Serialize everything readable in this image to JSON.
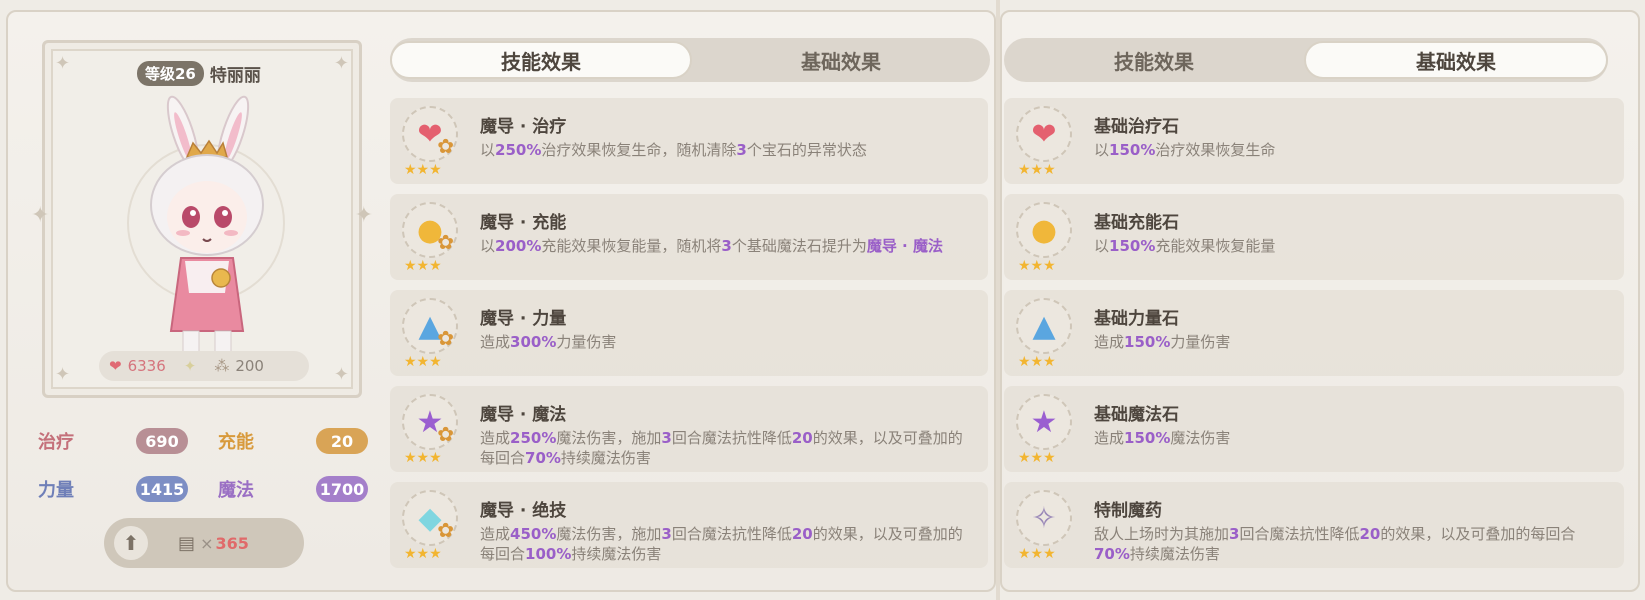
{
  "character": {
    "level_badge": "等级26",
    "name": "特丽丽",
    "hp": "6336",
    "gem_power": "200"
  },
  "attributes": [
    {
      "label": "治疗",
      "value": "690",
      "label_color": "#c4707a",
      "pill_color": "#b88f95"
    },
    {
      "label": "充能",
      "value": "20",
      "label_color": "#d89a3c",
      "pill_color": "#d9a456"
    },
    {
      "label": "力量",
      "value": "1415",
      "label_color": "#6f7fb8",
      "pill_color": "#7d8ec4"
    },
    {
      "label": "魔法",
      "value": "1700",
      "label_color": "#9a6fc4",
      "pill_color": "#a47fca"
    }
  ],
  "cost": {
    "prefix": "×",
    "amount": "365"
  },
  "left_tabs": {
    "skill": "技能效果",
    "base": "基础效果",
    "active": "skill"
  },
  "right_tabs": {
    "skill": "技能效果",
    "base": "基础效果",
    "active": "base"
  },
  "skills": [
    {
      "title": "魔导 · 治疗",
      "icon": "heart-gem-icon",
      "desc": [
        [
          "以"
        ],
        [
          "250%",
          1
        ],
        [
          "治疗效果恢复生命，随机清除"
        ],
        [
          "3",
          1
        ],
        [
          "个宝石的异常状态"
        ]
      ]
    },
    {
      "title": "魔导 · 充能",
      "icon": "energy-gem-icon",
      "desc": [
        [
          "以"
        ],
        [
          "200%",
          1
        ],
        [
          "充能效果恢复能量，随机将"
        ],
        [
          "3",
          1
        ],
        [
          "个基础魔法石提升为"
        ],
        [
          "魔导 · 魔法",
          1
        ]
      ]
    },
    {
      "title": "魔导 · 力量",
      "icon": "power-gem-icon",
      "desc": [
        [
          "造成"
        ],
        [
          "300%",
          1
        ],
        [
          "力量伤害"
        ]
      ]
    },
    {
      "title": "魔导 · 魔法",
      "icon": "magic-gem-icon",
      "desc": [
        [
          "造成"
        ],
        [
          "250%",
          1
        ],
        [
          "魔法伤害，施加"
        ],
        [
          "3",
          1
        ],
        [
          "回合魔法抗性降低"
        ],
        [
          "20",
          1
        ],
        [
          "的效果，以及可叠加的每回合"
        ],
        [
          "70%",
          1
        ],
        [
          "持续魔法伤害"
        ]
      ]
    },
    {
      "title": "魔导 · 绝技",
      "icon": "diamond-gem-icon",
      "desc": [
        [
          "造成"
        ],
        [
          "450%",
          1
        ],
        [
          "魔法伤害，施加"
        ],
        [
          "3",
          1
        ],
        [
          "回合魔法抗性降低"
        ],
        [
          "20",
          1
        ],
        [
          "的效果，以及可叠加的每回合"
        ],
        [
          "100%",
          1
        ],
        [
          "持续魔法伤害"
        ]
      ]
    }
  ],
  "base_effects": [
    {
      "title": "基础治疗石",
      "icon": "heart-stone-icon",
      "desc": [
        [
          "以"
        ],
        [
          "150%",
          1
        ],
        [
          "治疗效果恢复生命"
        ]
      ]
    },
    {
      "title": "基础充能石",
      "icon": "energy-stone-icon",
      "desc": [
        [
          "以"
        ],
        [
          "150%",
          1
        ],
        [
          "充能效果恢复能量"
        ]
      ]
    },
    {
      "title": "基础力量石",
      "icon": "power-stone-icon",
      "desc": [
        [
          "造成"
        ],
        [
          "150%",
          1
        ],
        [
          "力量伤害"
        ]
      ]
    },
    {
      "title": "基础魔法石",
      "icon": "magic-stone-icon",
      "desc": [
        [
          "造成"
        ],
        [
          "150%",
          1
        ],
        [
          "魔法伤害"
        ]
      ]
    },
    {
      "title": "特制魔药",
      "icon": "potion-icon",
      "desc": [
        [
          "敌人上场时为其施加"
        ],
        [
          "3",
          1
        ],
        [
          "回合魔法抗性降低"
        ],
        [
          "20",
          1
        ],
        [
          "的效果，以及可叠加的每回合"
        ],
        [
          "70%",
          1
        ],
        [
          "持续魔法伤害"
        ]
      ]
    }
  ],
  "colors": {
    "highlight": "#9a5fc8",
    "star": "#f2b531",
    "heart": "#e4606f",
    "energy": "#f0b73a",
    "power": "#5aa6e0",
    "magic": "#9a5ed0"
  }
}
